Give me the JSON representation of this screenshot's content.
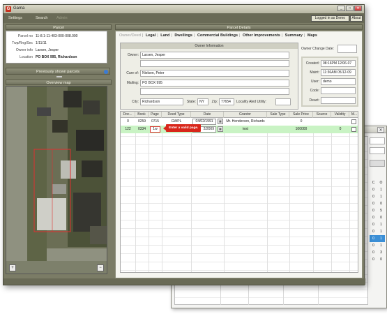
{
  "app": {
    "title": "Gama",
    "icon": "app-logo-icon"
  },
  "window_buttons": [
    "_",
    "□",
    "✕"
  ],
  "menu": {
    "settings": "Settings",
    "search": "Search",
    "admin": "Admin"
  },
  "user": {
    "logged_in": "Logged in as Demo",
    "about": "About"
  },
  "left": {
    "parcel_header": "Parcel",
    "parcel_fields": [
      {
        "label": "Parcel no",
        "value": "11-8.1-11-403-000-008.000"
      },
      {
        "label": "Twp/Rng/Sec",
        "value": "1/11/11"
      },
      {
        "label": "Owner info",
        "value": "Larsen, Jesper"
      },
      {
        "label": "Location",
        "value": "PO BOX 995, Richardson"
      }
    ],
    "previous_parcels": "Previously shown parcels",
    "overview_header": "Overview map"
  },
  "details": {
    "header": "Parcel Details",
    "tabs": [
      "Owner/Deed",
      "Legal",
      "Land",
      "Dwellings",
      "Commercial Buildings",
      "Other Improvements",
      "Summary",
      "Maps"
    ],
    "active_tab": "Owner/Deed",
    "owner": {
      "header": "Owner Information",
      "owner_label": "Owner:",
      "owner": "Larsen, Jesper",
      "careof_label": "Care of:",
      "care_of": "Nielsen, Peter",
      "mailing_label": "Mailing:",
      "mailing": "PO BOX 995",
      "city_label": "City:",
      "city": "Richardson",
      "state_label": "State:",
      "state": "NY",
      "zip_label": "Zip:",
      "zip": "77654",
      "utility_label": "Locality Aled Utility:"
    },
    "owner_change_date_label": "Owner Change Date:",
    "meta": [
      {
        "label": "Created:",
        "value": "08:16PM 12/06-07"
      },
      {
        "label": "Maint:",
        "value": "11:36AM 05/12-09"
      },
      {
        "label": "User:",
        "value": "demo"
      },
      {
        "label": "Code:",
        "value": ""
      },
      {
        "label": "Deact:",
        "value": ""
      }
    ],
    "table": {
      "columns": [
        "Doc...",
        "Book",
        "Page",
        "Deed Type",
        "Date",
        "Grantor",
        "Sale Type",
        "Sale Price",
        "Source",
        "Validity",
        "M..."
      ],
      "rows": [
        {
          "doc": "0",
          "book": "0259",
          "page": "0715",
          "deed_type": "GWPL",
          "date": "04/02/1991",
          "grantor": "Mr. Henderson, Richards",
          "sale_type": "",
          "sale_price": "0",
          "source": "",
          "validity": ""
        },
        {
          "doc": "122",
          "book": "0334",
          "page": "1w",
          "deed_type": "",
          "date": "2/2009",
          "grantor": "test",
          "sale_type": "",
          "sale_price": "100000",
          "source": "",
          "validity": "0"
        }
      ],
      "error_tooltip": "Enter a valid page."
    }
  },
  "background_window": {
    "cells": [
      {
        "a": "C",
        "b": "O"
      },
      {
        "a": "0",
        "b": "1"
      },
      {
        "a": "0",
        "b": "1"
      },
      {
        "a": "0",
        "b": "0"
      },
      {
        "a": "0",
        "b": "5"
      },
      {
        "a": "0",
        "b": "0"
      },
      {
        "a": "0",
        "b": "1"
      },
      {
        "a": "0",
        "b": "1"
      },
      {
        "a": "0",
        "b": "1"
      },
      {
        "a": "0",
        "b": "1"
      },
      {
        "a": "0",
        "b": "3"
      },
      {
        "a": "0",
        "b": "0"
      }
    ],
    "selected_index": 8
  }
}
